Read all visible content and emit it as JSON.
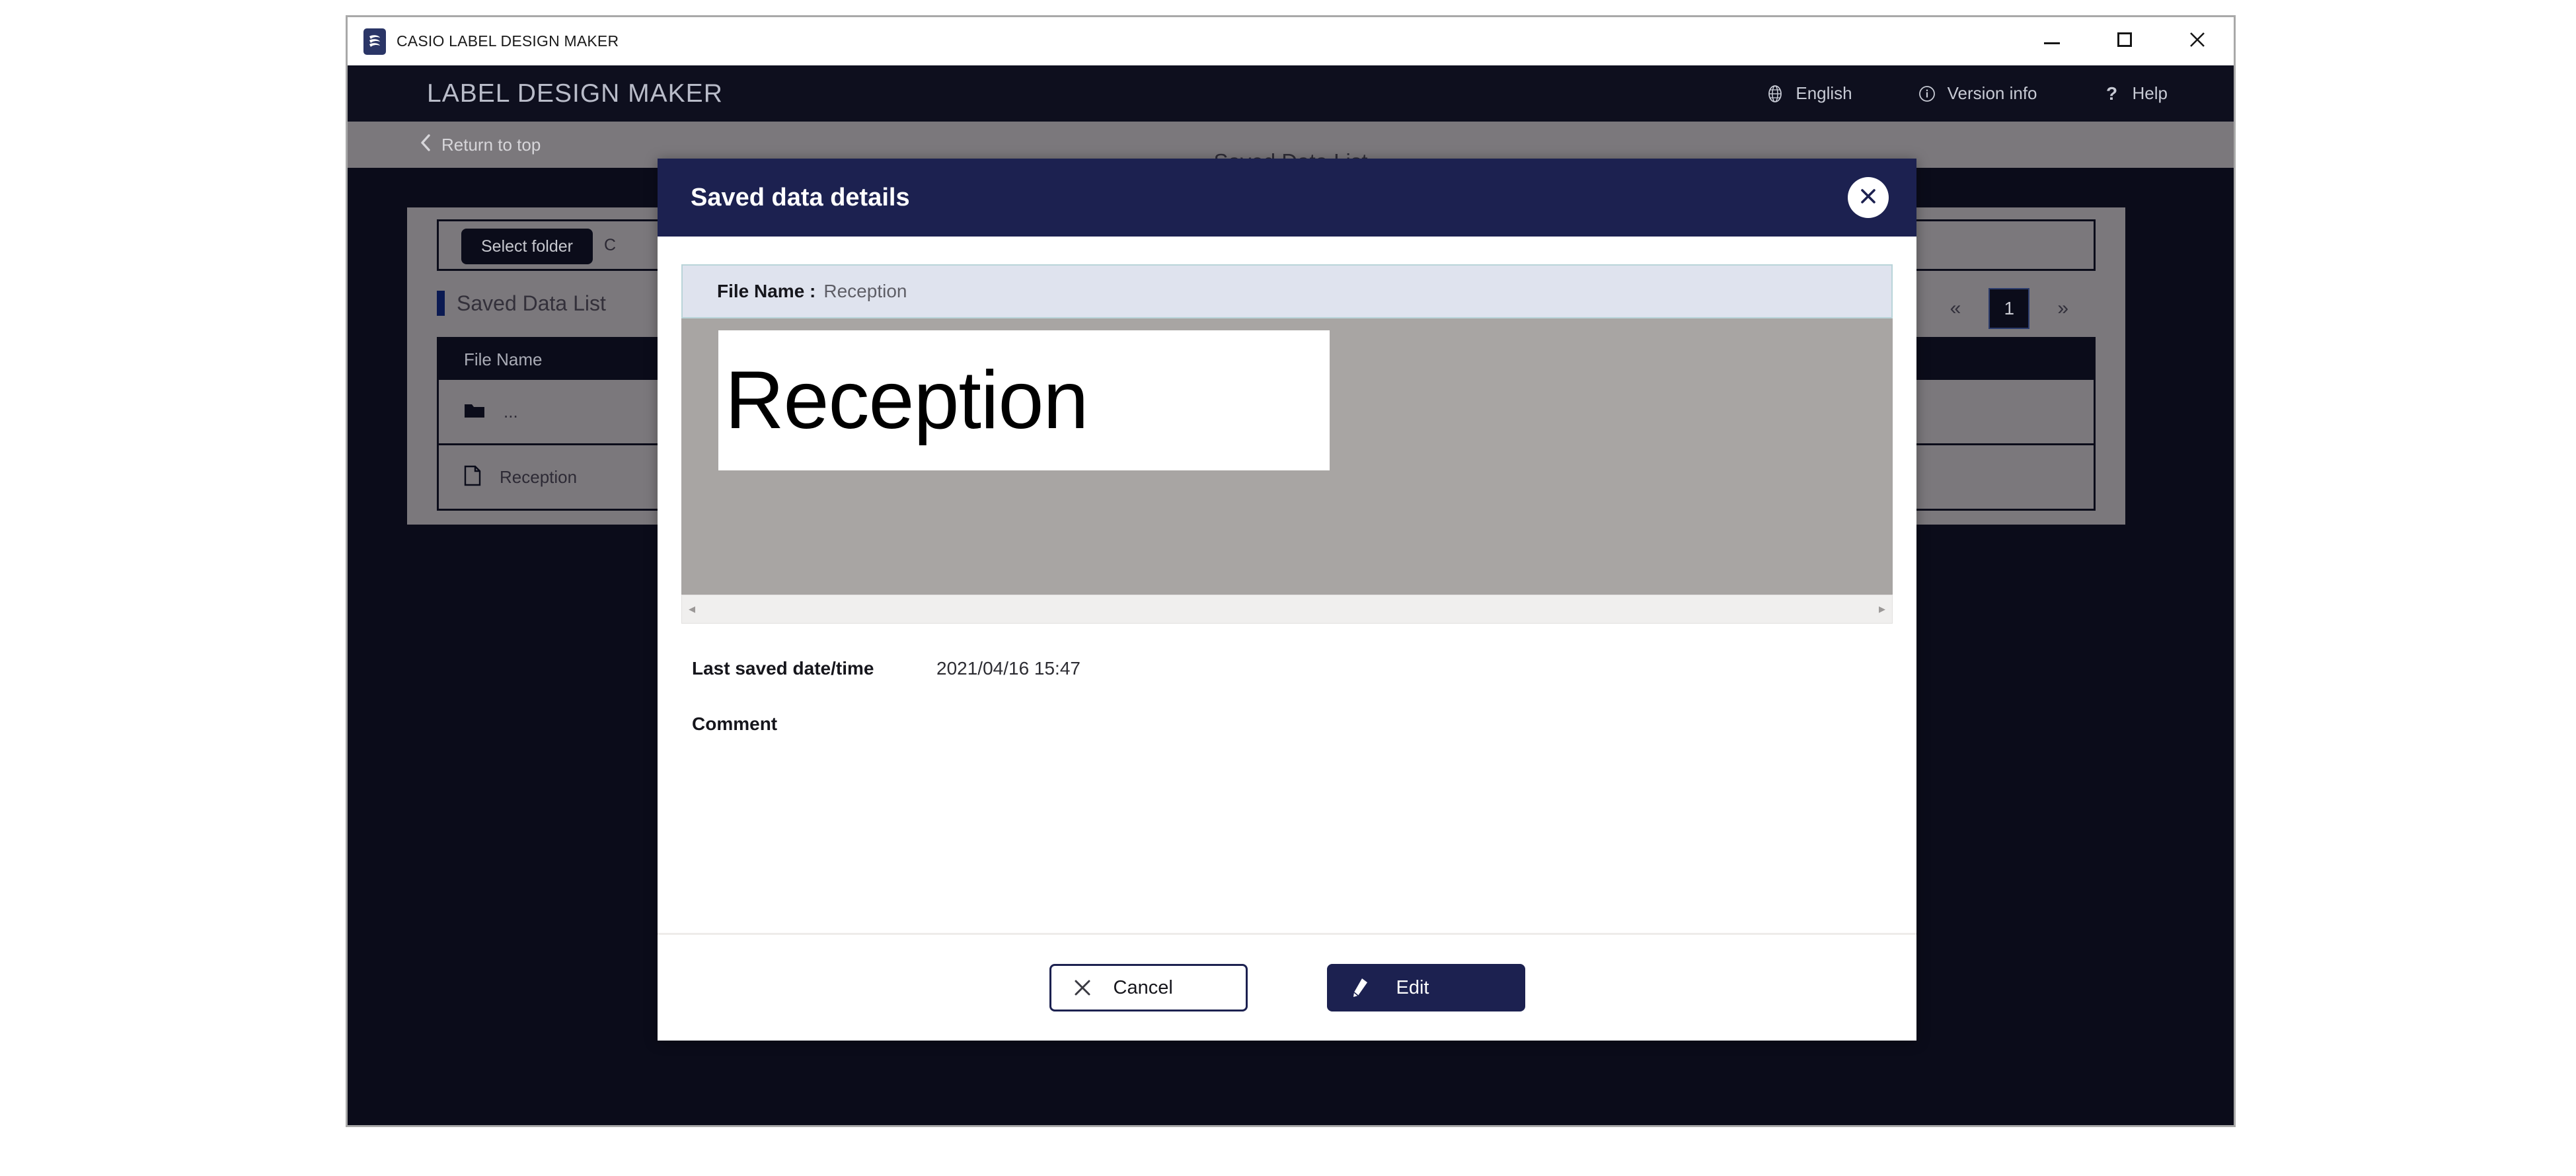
{
  "window": {
    "title": "CASIO LABEL DESIGN MAKER",
    "logo_icon": "casio-logo-icon",
    "controls": {
      "minimize": "minimize-icon",
      "maximize": "maximize-icon",
      "close": "close-icon"
    }
  },
  "header": {
    "brand": "LABEL DESIGN MAKER",
    "actions": [
      {
        "icon": "globe-icon",
        "label": "English"
      },
      {
        "icon": "info-circle-icon",
        "label": "Version info"
      },
      {
        "icon": "question-mark-icon",
        "label": "Help"
      }
    ]
  },
  "subnav": {
    "back_icon": "chevron-left-icon",
    "back_label": "Return to top",
    "page_title": "Saved Data List"
  },
  "main": {
    "select_folder_label": "Select folder",
    "folder_path": "C",
    "section_title": "Saved Data List",
    "pagination": {
      "first_label": "«",
      "current_page": "1",
      "last_label": "»"
    },
    "table": {
      "columns": [
        "File Name"
      ],
      "rows": [
        {
          "icon": "folder-icon",
          "name": "..."
        },
        {
          "icon": "file-icon",
          "name": "Reception"
        }
      ]
    }
  },
  "modal": {
    "title": "Saved data details",
    "close_icon": "close-circle-icon",
    "file_name_label": "File Name :",
    "file_name_value": "Reception",
    "preview": {
      "label_text": "Reception",
      "scroll_left_icon": "scroll-left-arrow",
      "scroll_right_icon": "scroll-right-arrow"
    },
    "fields": [
      {
        "label": "Last saved date/time",
        "value": "2021/04/16 15:47"
      },
      {
        "label": "Comment",
        "value": ""
      }
    ],
    "footer": {
      "cancel": {
        "icon": "x-icon",
        "label": "Cancel"
      },
      "edit": {
        "icon": "pencil-icon",
        "label": "Edit"
      }
    }
  },
  "colors": {
    "brand_dark": "#0e0f1e",
    "modal_header": "#1c2150",
    "accent_navy": "#0b1a52",
    "subnav_grey": "#7b787c",
    "filename_bar": "#dfe3ee",
    "preview_bg": "#a8a5a3"
  }
}
